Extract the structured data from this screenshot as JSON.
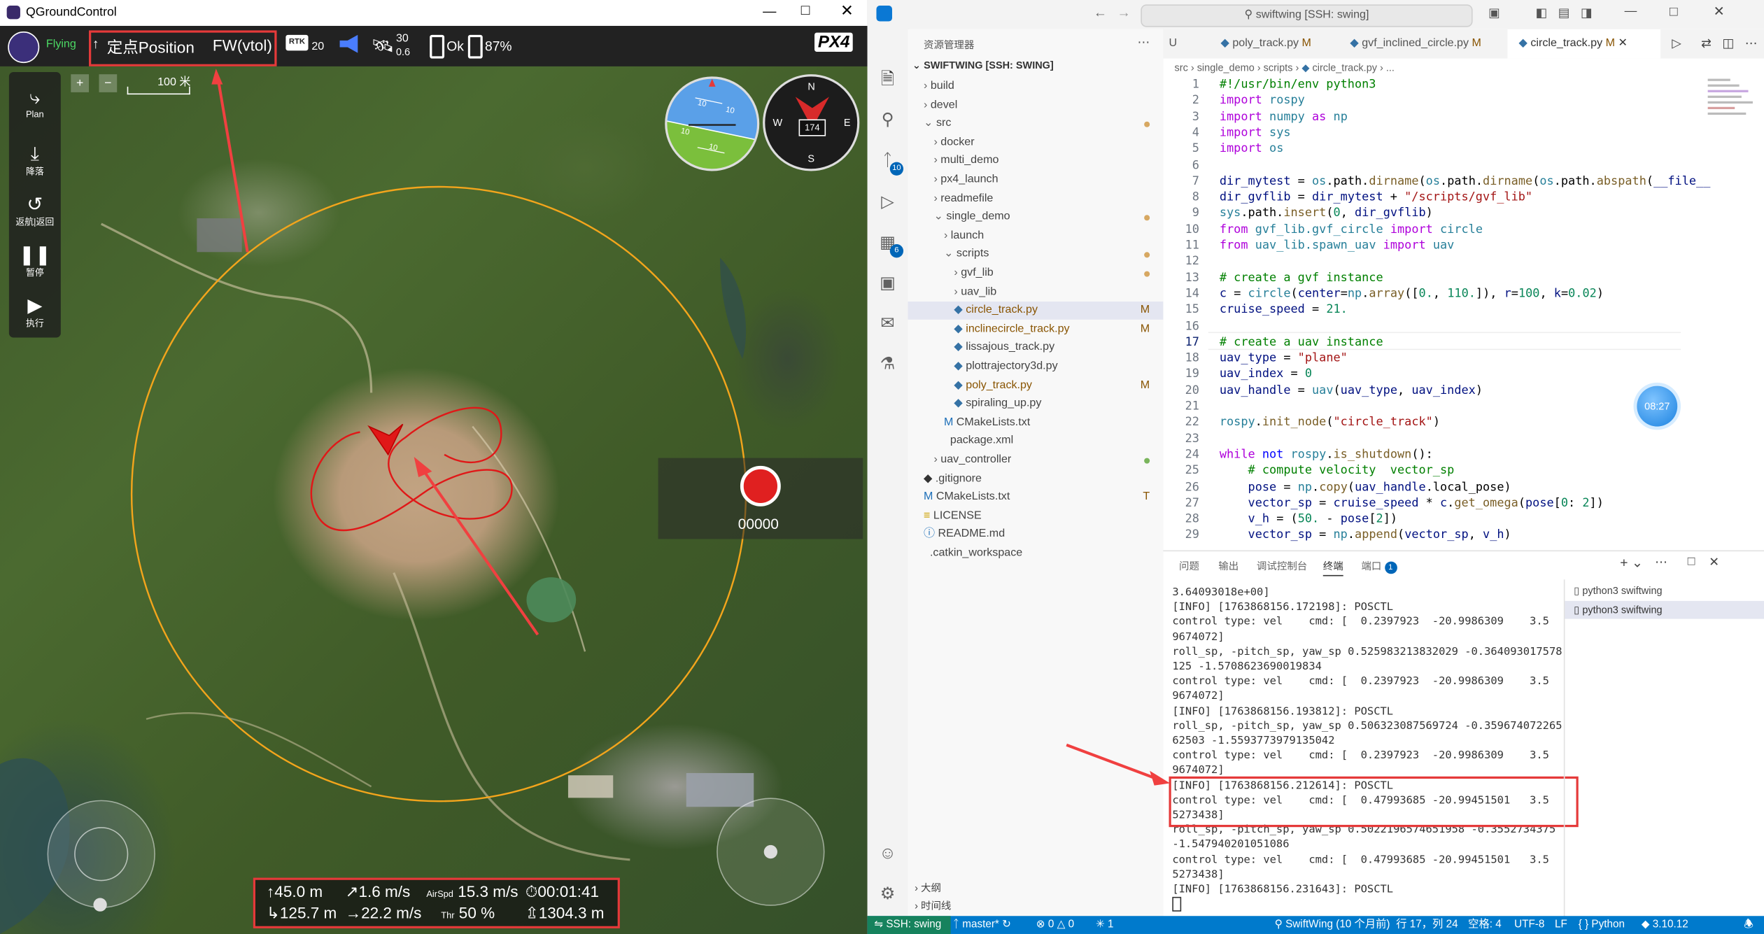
{
  "qgc": {
    "window_title": "QGroundControl",
    "flight_state": "Flying",
    "flight_mode": "定点Position",
    "vehicle_type": "FW(vtol)",
    "rtk_label": "RTK",
    "rtk_value": "20",
    "satellites": "30",
    "hdop": "0.6",
    "battery_status": "Ok",
    "battery_percent": "87%",
    "px4_logo": "PX4",
    "scale_label": "100 米",
    "tools": [
      {
        "icon": "plan-icon",
        "label": "Plan"
      },
      {
        "icon": "land-icon",
        "label": "降落"
      },
      {
        "icon": "return-icon",
        "label": "返航|返回"
      },
      {
        "icon": "pause-icon",
        "label": "暂停"
      },
      {
        "icon": "play-icon",
        "label": "执行"
      }
    ],
    "record_counter": "00000",
    "heading": "174",
    "compass": {
      "n": "N",
      "s": "S",
      "e": "E",
      "w": "W"
    },
    "attitude_ticks": [
      "10",
      "10",
      "10",
      "10"
    ],
    "telemetry": {
      "alt_rel": "45.0 m",
      "climb": "1.6 m/s",
      "airspeed_label": "AirSpd",
      "airspeed": "15.3 m/s",
      "flight_time": "00:01:41",
      "distance": "125.7 m",
      "ground_speed": "22.2 m/s",
      "throttle_label": "Thr",
      "throttle": "50 %",
      "alt_amsl": "1304.3 m"
    }
  },
  "vscode": {
    "search": "swiftwing [SSH: swing]",
    "explorer_title": "资源管理器",
    "root": "SWIFTWING [SSH: SWING]",
    "tree": [
      {
        "label": "build",
        "indent": 0,
        "kind": "folder"
      },
      {
        "label": "devel",
        "indent": 0,
        "kind": "folder"
      },
      {
        "label": "src",
        "indent": 0,
        "kind": "folder-open",
        "mark": "dot-orange"
      },
      {
        "label": "docker",
        "indent": 1,
        "kind": "folder"
      },
      {
        "label": "multi_demo",
        "indent": 1,
        "kind": "folder"
      },
      {
        "label": "px4_launch",
        "indent": 1,
        "kind": "folder"
      },
      {
        "label": "readmefile",
        "indent": 1,
        "kind": "folder"
      },
      {
        "label": "single_demo",
        "indent": 1,
        "kind": "folder-open",
        "mark": "dot-orange"
      },
      {
        "label": "launch",
        "indent": 2,
        "kind": "folder"
      },
      {
        "label": "scripts",
        "indent": 2,
        "kind": "folder-open",
        "mark": "dot-orange"
      },
      {
        "label": "gvf_lib",
        "indent": 3,
        "kind": "folder",
        "mark": "dot-orange"
      },
      {
        "label": "uav_lib",
        "indent": 3,
        "kind": "folder"
      },
      {
        "label": "circle_track.py",
        "indent": 3,
        "kind": "py",
        "mark": "M",
        "selected": true
      },
      {
        "label": "inclinecircle_track.py",
        "indent": 3,
        "kind": "py",
        "mark": "M"
      },
      {
        "label": "lissajous_track.py",
        "indent": 3,
        "kind": "py"
      },
      {
        "label": "plottrajectory3d.py",
        "indent": 3,
        "kind": "py"
      },
      {
        "label": "poly_track.py",
        "indent": 3,
        "kind": "py",
        "mark": "M"
      },
      {
        "label": "spiraling_up.py",
        "indent": 3,
        "kind": "py"
      },
      {
        "label": "CMakeLists.txt",
        "indent": 2,
        "kind": "cmake"
      },
      {
        "label": "package.xml",
        "indent": 2,
        "kind": "xml"
      },
      {
        "label": "uav_controller",
        "indent": 1,
        "kind": "folder",
        "mark": "dot-green"
      },
      {
        "label": ".gitignore",
        "indent": 0,
        "kind": "git"
      },
      {
        "label": "CMakeLists.txt",
        "indent": 0,
        "kind": "cmake",
        "mark": "T"
      },
      {
        "label": "LICENSE",
        "indent": 0,
        "kind": "license"
      },
      {
        "label": "README.md",
        "indent": 0,
        "kind": "md"
      },
      {
        "label": ".catkin_workspace",
        "indent": 0,
        "kind": "file"
      }
    ],
    "outline_label": "大纲",
    "timeline_label": "时间线",
    "tabs": [
      {
        "label": "U",
        "mod": ""
      },
      {
        "label": "poly_track.py",
        "mod": "M"
      },
      {
        "label": "gvf_inclined_circle.py",
        "mod": "M"
      },
      {
        "label": "circle_track.py",
        "mod": "M"
      }
    ],
    "breadcrumb": [
      "src",
      "single_demo",
      "scripts",
      "circle_track.py",
      "..."
    ],
    "timer_badge": "08:27",
    "panel_tabs": [
      "问题",
      "输出",
      "调试控制台",
      "终端",
      "端口"
    ],
    "ports_badge": "1",
    "terminals": [
      "python3 swiftwing",
      "python3 swiftwing"
    ],
    "terminal_lines": [
      "3.64093018e+00]",
      "[INFO] [1763868156.172198]: POSCTL",
      "control type: vel    cmd: [  0.2397923  -20.9986309    3.5",
      "9674072]",
      "roll_sp, -pitch_sp, yaw_sp 0.525983213832029 -0.364093017578",
      "125 -1.5708623690019834",
      "control type: vel    cmd: [  0.2397923  -20.9986309    3.5",
      "9674072]",
      "[INFO] [1763868156.193812]: POSCTL",
      "roll_sp, -pitch_sp, yaw_sp 0.506323087569724 -0.359674072265",
      "62503 -1.5593773979135042",
      "control type: vel    cmd: [  0.2397923  -20.9986309    3.5",
      "9674072]",
      "[INFO] [1763868156.212614]: POSCTL",
      "control type: vel    cmd: [  0.47993685 -20.99451501   3.5",
      "5273438]",
      "roll_sp, -pitch_sp, yaw_sp 0.5022196574651958 -0.3552734375",
      "-1.547940201051086",
      "control type: vel    cmd: [  0.47993685 -20.99451501   3.5",
      "5273438]",
      "[INFO] [1763868156.231643]: POSCTL"
    ],
    "status": {
      "remote": "SSH: swing",
      "branch": "master*",
      "errors": "0",
      "warnings": "0",
      "ports": "1",
      "blame": "SwiftWing (10 个月前)",
      "position": "行 17，列 24",
      "spaces": "空格: 4",
      "encoding": "UTF-8",
      "eol": "LF",
      "language": "Python",
      "version": "3.10.12"
    }
  }
}
